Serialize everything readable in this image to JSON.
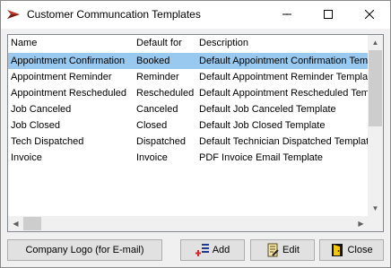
{
  "window": {
    "title": "Customer Communcation Templates",
    "icon": "app-logo-icon"
  },
  "list": {
    "columns": [
      "Name",
      "Default for",
      "Description"
    ],
    "rows": [
      {
        "name": "Appointment Confirmation",
        "default_for": "Booked",
        "description": "Default Appointment Confirmation Template"
      },
      {
        "name": "Appointment Reminder",
        "default_for": "Reminder",
        "description": "Default Appointment Reminder Template"
      },
      {
        "name": "Appointment Rescheduled",
        "default_for": "Rescheduled",
        "description": "Default Appointment Rescheduled Template"
      },
      {
        "name": "Job Canceled",
        "default_for": "Canceled",
        "description": "Default Job Canceled Template"
      },
      {
        "name": "Job Closed",
        "default_for": "Closed",
        "description": "Default Job Closed Template"
      },
      {
        "name": "Tech Dispatched",
        "default_for": "Dispatched",
        "description": "Default Technician Dispatched Template"
      },
      {
        "name": "Invoice",
        "default_for": "Invoice",
        "description": "PDF Invoice Email Template"
      }
    ],
    "selected_index": 0,
    "selection_color": "#99c9ef"
  },
  "buttons": {
    "company_logo": "Company Logo (for E-mail)",
    "add": "Add",
    "edit": "Edit",
    "close": "Close"
  }
}
